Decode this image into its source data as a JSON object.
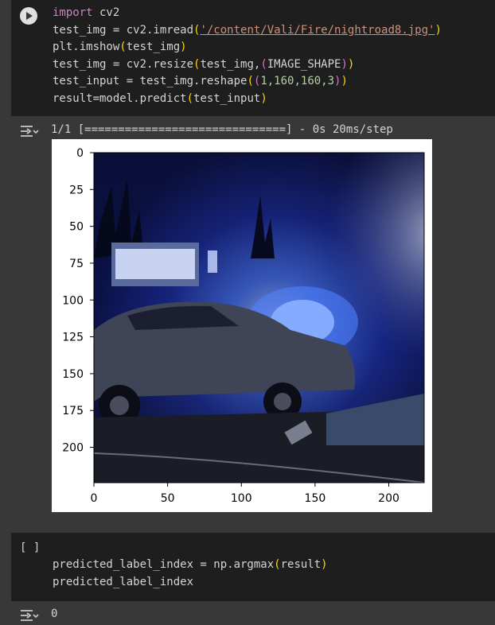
{
  "cell1": {
    "lines": [
      {
        "parts": [
          {
            "t": "import",
            "c": "kw"
          },
          {
            "t": " cv2",
            "c": ""
          }
        ]
      },
      {
        "parts": [
          {
            "t": "test_img = cv2.imread",
            "c": ""
          },
          {
            "t": "(",
            "c": "y"
          },
          {
            "t": "'/content/Vali/Fire/nightroad8.jpg'",
            "c": "str"
          },
          {
            "t": ")",
            "c": "y"
          }
        ]
      },
      {
        "parts": [
          {
            "t": "plt.imshow",
            "c": ""
          },
          {
            "t": "(",
            "c": "y"
          },
          {
            "t": "test_img",
            "c": ""
          },
          {
            "t": ")",
            "c": "y"
          }
        ]
      },
      {
        "parts": [
          {
            "t": "test_img = cv2.resize",
            "c": ""
          },
          {
            "t": "(",
            "c": "y"
          },
          {
            "t": "test_img,",
            "c": ""
          },
          {
            "t": "(",
            "c": "m"
          },
          {
            "t": "IMAGE_SHAPE",
            "c": ""
          },
          {
            "t": ")",
            "c": "m"
          },
          {
            "t": ")",
            "c": "y"
          }
        ]
      },
      {
        "parts": [
          {
            "t": "test_input = test_img.reshape",
            "c": ""
          },
          {
            "t": "(",
            "c": "y"
          },
          {
            "t": "(",
            "c": "m"
          },
          {
            "t": "1,160,160,3",
            "c": "num"
          },
          {
            "t": ")",
            "c": "m"
          },
          {
            "t": ")",
            "c": "y"
          }
        ]
      },
      {
        "parts": [
          {
            "t": "result=model.predict",
            "c": ""
          },
          {
            "t": "(",
            "c": "y"
          },
          {
            "t": "test_input",
            "c": ""
          },
          {
            "t": ")",
            "c": "y"
          }
        ]
      }
    ],
    "output_text": "1/1 [==============================] - 0s 20ms/step"
  },
  "figure": {
    "y_ticks": [
      "0",
      "25",
      "50",
      "75",
      "100",
      "125",
      "150",
      "175",
      "200"
    ],
    "x_ticks": [
      "0",
      "50",
      "100",
      "150",
      "200"
    ],
    "image_subject": "night street photo: car with blue fire and smoke"
  },
  "cell2": {
    "bracket": "[ ]",
    "lines": [
      {
        "parts": [
          {
            "t": "predicted_label_index = np.argmax",
            "c": ""
          },
          {
            "t": "(",
            "c": "y"
          },
          {
            "t": "result",
            "c": ""
          },
          {
            "t": ")",
            "c": "y"
          }
        ]
      },
      {
        "parts": [
          {
            "t": "predicted_label_index",
            "c": ""
          }
        ]
      }
    ],
    "output_text": "0"
  },
  "icons": {
    "run": "play-circle-icon",
    "output_toggle": "output-collapse-icon"
  },
  "colors": {
    "cell_bg": "#1e1e1e",
    "page_bg": "#383838",
    "keyword": "#c586c0",
    "string": "#ce9178",
    "bracket1": "#ffd700",
    "bracket2": "#da70d6",
    "number": "#b5cea8"
  }
}
